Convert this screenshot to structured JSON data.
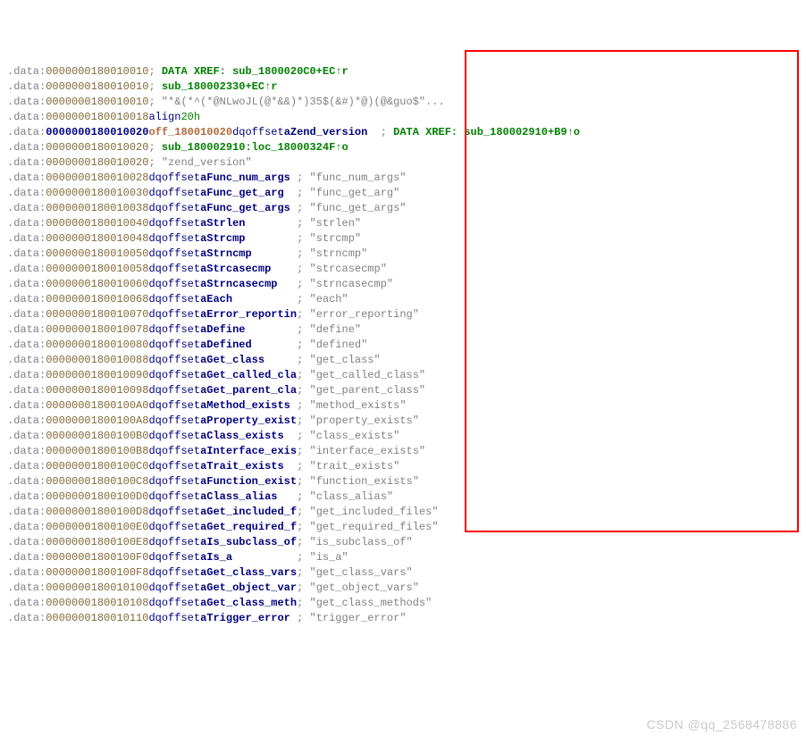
{
  "watermark": "CSDN @qq_2568478886",
  "header_rows": [
    {
      "seg": ".data:",
      "addr": "0000000180010010",
      "col2": "",
      "cmt_prefix": "; ",
      "xref_label": "DATA XREF: ",
      "xref_target": "sub_1800020C0+EC↑r"
    },
    {
      "seg": ".data:",
      "addr": "0000000180010010",
      "col2": "",
      "cmt_prefix": "; ",
      "xref_label": "",
      "xref_target": "sub_180002330+EC↑r"
    },
    {
      "seg": ".data:",
      "addr": "0000000180010010",
      "col2": "",
      "cmt_prefix": "; ",
      "xref_label": "",
      "xref_target": "",
      "plain": "\"*&(*^(*@NLwoJL(@*&&)*)35$(&#)*@)(@&guo$\"..."
    },
    {
      "seg": ".data:",
      "addr": "0000000180010018",
      "col2_kind": "align"
    }
  ],
  "row_main": {
    "seg": ".data:",
    "addr": "0000000180010020",
    "label": "off_180010020",
    "aname": "aZend_version",
    "xref_label": "DATA XREF: ",
    "xref_target": "sub_180002910+B9↑o"
  },
  "row_main2": {
    "seg": ".data:",
    "addr": "0000000180010020",
    "xref_target": "sub_180002910:loc_18000324F↑o"
  },
  "row_main3": {
    "seg": ".data:",
    "addr": "0000000180010020",
    "str": "\"zend_version\""
  },
  "offset_rows": [
    {
      "addr": "0000000180010028",
      "aname": "aFunc_num_args",
      "str": "\"func_num_args\""
    },
    {
      "addr": "0000000180010030",
      "aname": "aFunc_get_arg",
      "str": "\"func_get_arg\""
    },
    {
      "addr": "0000000180010038",
      "aname": "aFunc_get_args",
      "str": "\"func_get_args\""
    },
    {
      "addr": "0000000180010040",
      "aname": "aStrlen",
      "str": "\"strlen\""
    },
    {
      "addr": "0000000180010048",
      "aname": "aStrcmp",
      "str": "\"strcmp\""
    },
    {
      "addr": "0000000180010050",
      "aname": "aStrncmp",
      "str": "\"strncmp\""
    },
    {
      "addr": "0000000180010058",
      "aname": "aStrcasecmp",
      "str": "\"strcasecmp\""
    },
    {
      "addr": "0000000180010060",
      "aname": "aStrncasecmp",
      "str": "\"strncasecmp\""
    },
    {
      "addr": "0000000180010068",
      "aname": "aEach",
      "str": "\"each\""
    },
    {
      "addr": "0000000180010070",
      "aname": "aError_reportin",
      "str": "\"error_reporting\""
    },
    {
      "addr": "0000000180010078",
      "aname": "aDefine",
      "str": "\"define\""
    },
    {
      "addr": "0000000180010080",
      "aname": "aDefined",
      "str": "\"defined\""
    },
    {
      "addr": "0000000180010088",
      "aname": "aGet_class",
      "str": "\"get_class\""
    },
    {
      "addr": "0000000180010090",
      "aname": "aGet_called_cla",
      "str": "\"get_called_class\""
    },
    {
      "addr": "0000000180010098",
      "aname": "aGet_parent_cla",
      "str": "\"get_parent_class\""
    },
    {
      "addr": "00000001800100A0",
      "aname": "aMethod_exists",
      "str": "\"method_exists\""
    },
    {
      "addr": "00000001800100A8",
      "aname": "aProperty_exist",
      "str": "\"property_exists\""
    },
    {
      "addr": "00000001800100B0",
      "aname": "aClass_exists",
      "str": "\"class_exists\""
    },
    {
      "addr": "00000001800100B8",
      "aname": "aInterface_exis",
      "str": "\"interface_exists\""
    },
    {
      "addr": "00000001800100C0",
      "aname": "aTrait_exists",
      "str": "\"trait_exists\""
    },
    {
      "addr": "00000001800100C8",
      "aname": "aFunction_exist",
      "str": "\"function_exists\""
    },
    {
      "addr": "00000001800100D0",
      "aname": "aClass_alias",
      "str": "\"class_alias\""
    },
    {
      "addr": "00000001800100D8",
      "aname": "aGet_included_f",
      "str": "\"get_included_files\""
    },
    {
      "addr": "00000001800100E0",
      "aname": "aGet_required_f",
      "str": "\"get_required_files\""
    },
    {
      "addr": "00000001800100E8",
      "aname": "aIs_subclass_of",
      "str": "\"is_subclass_of\""
    },
    {
      "addr": "00000001800100F0",
      "aname": "aIs_a",
      "str": "\"is_a\""
    },
    {
      "addr": "00000001800100F8",
      "aname": "aGet_class_vars",
      "str": "\"get_class_vars\""
    },
    {
      "addr": "0000000180010100",
      "aname": "aGet_object_var",
      "str": "\"get_object_vars\""
    },
    {
      "addr": "0000000180010108",
      "aname": "aGet_class_meth",
      "str": "\"get_class_methods\""
    },
    {
      "addr": "0000000180010110",
      "aname": "aTrigger_error",
      "str": "\"trigger_error\""
    }
  ],
  "tokens": {
    "dq": "dq",
    "offset": "offset",
    "align": "align",
    "twentyh": "20h",
    "semi": "; ",
    "seg": ".data:"
  }
}
